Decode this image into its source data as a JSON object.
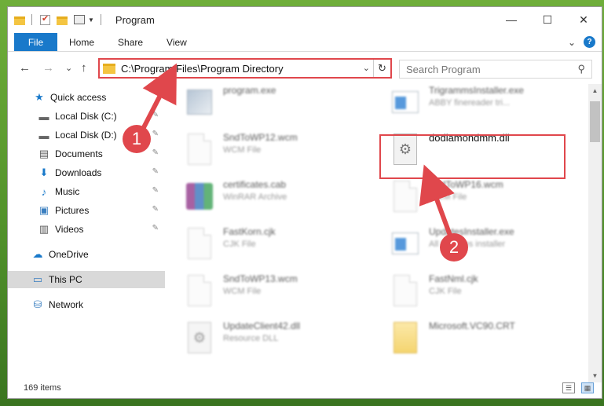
{
  "window": {
    "title": "Program",
    "controls": {
      "minimize": "—",
      "maximize": "☐",
      "close": "✕"
    }
  },
  "ribbon": {
    "tabs": [
      "File",
      "Home",
      "Share",
      "View"
    ],
    "collapse_icon": "⌄",
    "help_icon": "?"
  },
  "nav": {
    "back": "←",
    "forward": "→",
    "recent": "⌄",
    "up": "↑",
    "address": "C:\\Program Files\\Program Directory",
    "address_dropdown": "⌄",
    "refresh": "↻",
    "search_placeholder": "Search Program",
    "search_icon": "⚲"
  },
  "sidebar": {
    "items": [
      {
        "label": "Quick access",
        "icon": "★",
        "pinned": false
      },
      {
        "label": "Local Disk (C:)",
        "icon": "▬",
        "pinned": true
      },
      {
        "label": "Local Disk (D:)",
        "icon": "▬",
        "pinned": true
      },
      {
        "label": "Documents",
        "icon": "▤",
        "pinned": true
      },
      {
        "label": "Downloads",
        "icon": "⬇",
        "pinned": true
      },
      {
        "label": "Music",
        "icon": "♪",
        "pinned": true
      },
      {
        "label": "Pictures",
        "icon": "▣",
        "pinned": true
      },
      {
        "label": "Videos",
        "icon": "▥",
        "pinned": true
      },
      {
        "label": "OneDrive",
        "icon": "☁",
        "pinned": false
      },
      {
        "label": "This PC",
        "icon": "▭",
        "pinned": false,
        "selected": true
      },
      {
        "label": "Network",
        "icon": "⛁",
        "pinned": false
      }
    ],
    "pin_icon": "📌"
  },
  "files": [
    {
      "name": "program.exe",
      "type": ""
    },
    {
      "name": "TrigrammsInstaller.exe",
      "type": "ABBY finereader tri..."
    },
    {
      "name": "SndToWP12.wcm",
      "type": "WCM File"
    },
    {
      "name": "dodiamondmm.dll",
      "type": ""
    },
    {
      "name": "certificates.cab",
      "type": "WinRAR Archive"
    },
    {
      "name": "SndToWP16.wcm",
      "type": "WCM File"
    },
    {
      "name": "FastKorn.cjk",
      "type": "CJK File"
    },
    {
      "name": "UpdatesInstaller.exe",
      "type": "All Updates installer"
    },
    {
      "name": "SndToWP13.wcm",
      "type": "WCM File"
    },
    {
      "name": "FastNml.cjk",
      "type": "CJK File"
    },
    {
      "name": "UpdateClient42.dll",
      "type": "Resource DLL"
    },
    {
      "name": "Microsoft.VC90.CRT",
      "type": ""
    }
  ],
  "status": {
    "item_count": "169 items"
  },
  "annotations": {
    "step1": "1",
    "step2": "2",
    "color": "#e0474c"
  }
}
